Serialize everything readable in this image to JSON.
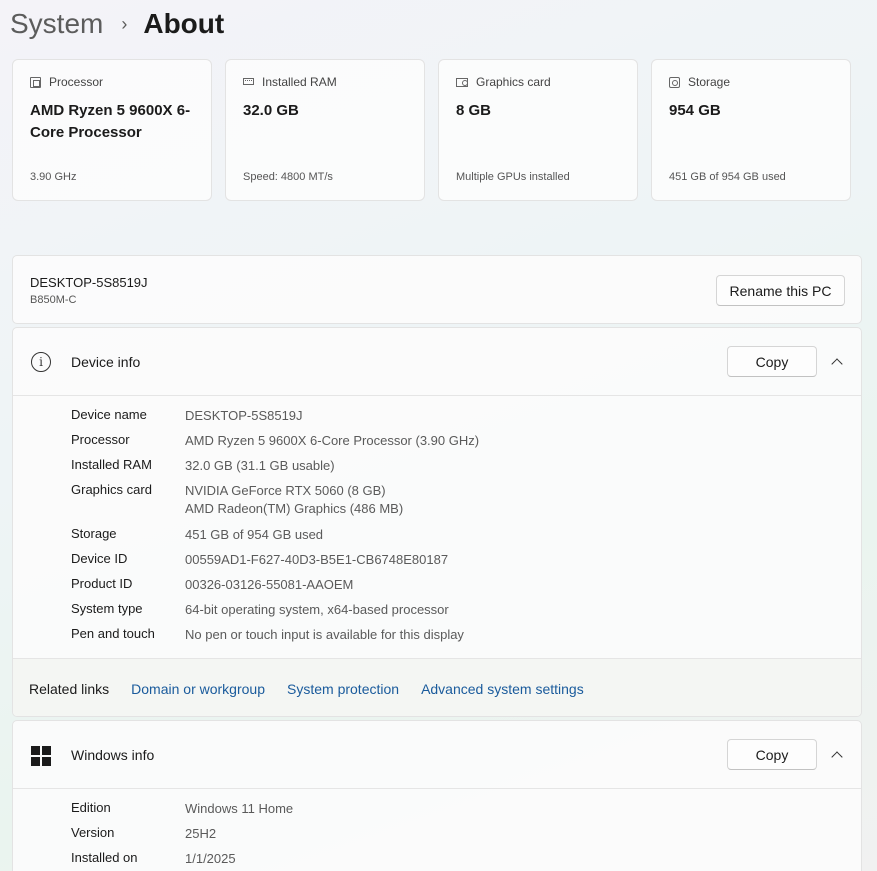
{
  "breadcrumb": {
    "parent": "System",
    "separator": "›",
    "current": "About"
  },
  "cards": [
    {
      "icon": "processor-icon",
      "title": "Processor",
      "value": "AMD Ryzen 5 9600X 6-Core Processor",
      "sub": "3.90 GHz"
    },
    {
      "icon": "ram-icon",
      "title": "Installed RAM",
      "value": "32.0 GB",
      "sub": "Speed: 4800 MT/s"
    },
    {
      "icon": "graphics-card-icon",
      "title": "Graphics card",
      "value": "8 GB",
      "sub": "Multiple GPUs installed"
    },
    {
      "icon": "storage-icon",
      "title": "Storage",
      "value": "954 GB",
      "sub": "451 GB of 954 GB used"
    }
  ],
  "pc": {
    "name": "DESKTOP-5S8519J",
    "model": "B850M-C",
    "rename_label": "Rename this PC"
  },
  "device_info": {
    "title": "Device info",
    "copy_label": "Copy",
    "rows": [
      {
        "label": "Device name",
        "value": "DESKTOP-5S8519J"
      },
      {
        "label": "Processor",
        "value": "AMD Ryzen 5 9600X 6-Core Processor (3.90 GHz)"
      },
      {
        "label": "Installed RAM",
        "value": "32.0 GB (31.1 GB usable)"
      },
      {
        "label": "Graphics card",
        "value": "NVIDIA GeForce RTX 5060 (8 GB)",
        "value2": "AMD Radeon(TM) Graphics (486 MB)"
      },
      {
        "label": "Storage",
        "value": "451 GB of 954 GB used"
      },
      {
        "label": "Device ID",
        "value": "00559AD1-F627-40D3-B5E1-CB6748E80187"
      },
      {
        "label": "Product ID",
        "value": "00326-03126-55081-AAOEM"
      },
      {
        "label": "System type",
        "value": "64-bit operating system, x64-based processor"
      },
      {
        "label": "Pen and touch",
        "value": "No pen or touch input is available for this display"
      }
    ]
  },
  "related_links": {
    "title": "Related links",
    "links": [
      "Domain or workgroup",
      "System protection",
      "Advanced system settings"
    ]
  },
  "windows_info": {
    "title": "Windows info",
    "copy_label": "Copy",
    "rows": [
      {
        "label": "Edition",
        "value": "Windows 11 Home"
      },
      {
        "label": "Version",
        "value": "25H2"
      },
      {
        "label": "Installed on",
        "value": "1/1/2025"
      }
    ]
  }
}
